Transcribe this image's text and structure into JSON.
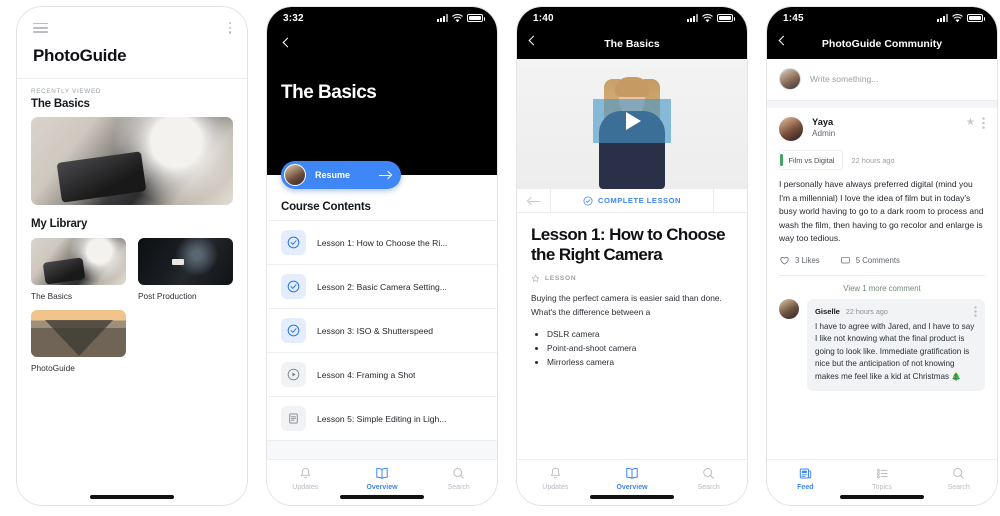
{
  "phones": [
    {
      "id": "home",
      "app_title": "PhotoGuide",
      "menu_icon": "hamburger-icon",
      "overflow_icon": "kebab-icon",
      "recently_viewed": {
        "eyebrow": "RECENTLY VIEWED",
        "course": "The Basics"
      },
      "library": {
        "heading": "My Library",
        "items": [
          {
            "label": "The Basics",
            "art": "img-desk"
          },
          {
            "label": "Post Production",
            "art": "img-dark"
          },
          {
            "label": "PhotoGuide",
            "art": "img-tracks"
          }
        ]
      }
    },
    {
      "id": "course",
      "status": {
        "time": "3:32"
      },
      "title": "The Basics",
      "resume_label": "Resume",
      "contents_heading": "Course Contents",
      "lessons": [
        {
          "label": "Lesson 1: How to Choose the Ri...",
          "state": "done",
          "icon": "check-circle-icon"
        },
        {
          "label": "Lesson 2: Basic Camera Setting...",
          "state": "done",
          "icon": "check-circle-icon"
        },
        {
          "label": "Lesson 3: ISO & Shutterspeed",
          "state": "done",
          "icon": "check-circle-icon"
        },
        {
          "label": "Lesson 4: Framing a Shot",
          "state": "idle",
          "icon": "play-circle-icon"
        },
        {
          "label": "Lesson 5: Simple Editing in Ligh...",
          "state": "idle",
          "icon": "document-icon"
        }
      ],
      "tabs": [
        {
          "label": "Updates",
          "icon": "bell-icon",
          "active": false
        },
        {
          "label": "Overview",
          "icon": "book-icon",
          "active": true
        },
        {
          "label": "Search",
          "icon": "search-icon",
          "active": false
        }
      ]
    },
    {
      "id": "lesson",
      "status": {
        "time": "1:40"
      },
      "nav_title": "The Basics",
      "complete_label": "COMPLETE LESSON",
      "prev_icon": "arrow-left-icon",
      "next_icon": "arrow-right-icon",
      "heading": "Lesson 1: How to Choose the Right Camera",
      "meta_label": "LESSON",
      "meta_icon": "star-outline-icon",
      "paragraph": "Buying the perfect camera is easier said than done. What's the difference between a",
      "bullets": [
        "DSLR camera",
        "Point-and-shoot camera",
        "Mirrorless camera"
      ],
      "tabs": [
        {
          "label": "Updates",
          "icon": "bell-icon",
          "active": false
        },
        {
          "label": "Overview",
          "icon": "book-icon",
          "active": true
        },
        {
          "label": "Search",
          "icon": "search-icon",
          "active": false
        }
      ]
    },
    {
      "id": "community",
      "status": {
        "time": "1:45"
      },
      "nav_title": "PhotoGuide Community",
      "composer_placeholder": "Write something...",
      "post": {
        "author": "Yaya",
        "role": "Admin",
        "topic_tag": "Film vs Digital",
        "timestamp": "22 hours ago",
        "body": "I personally have always preferred digital (mind you I'm a millennial) I love the idea of film but in today's busy world having to go to a dark room to process and wash the film, then having to go recolor and enlarge is way too tedious.",
        "likes": "3 Likes",
        "comments": "5 Comments",
        "like_icon": "heart-icon",
        "comment_icon": "comment-icon"
      },
      "view_more": "View 1 more comment",
      "comment": {
        "author": "Giselle",
        "timestamp": "22 hours ago",
        "body": "I have to agree with Jared, and I have to say I like not knowing what the final product is going to look like. Immediate gratification is nice but the anticipation of not knowing makes me feel like a kid at Christmas 🎄"
      },
      "tabs": [
        {
          "label": "Feed",
          "icon": "feed-icon",
          "active": true
        },
        {
          "label": "Topics",
          "icon": "list-icon",
          "active": false
        },
        {
          "label": "Search",
          "icon": "search-icon",
          "active": false
        }
      ]
    }
  ],
  "colors": {
    "accent": "#3f86f7",
    "accent_soft": "#e3edfd",
    "green": "#49a46a",
    "muted": "#9aa0a6"
  }
}
